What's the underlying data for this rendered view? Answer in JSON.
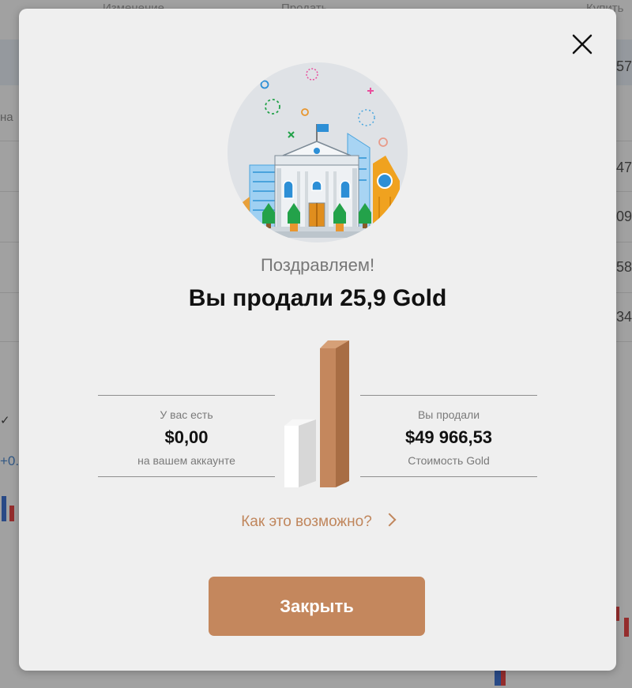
{
  "background": {
    "columns": [
      "Изменение",
      "Продать",
      "Купить"
    ],
    "side_values": [
      "57",
      "47",
      "09",
      "58",
      "34"
    ],
    "left_label": "на",
    "left_value": "+0.",
    "left_check": "✓"
  },
  "dialog": {
    "greeting": "Поздравляем!",
    "headline": "Вы продали 25,9 Gold",
    "balance": {
      "label": "У вас есть",
      "value": "$0,00",
      "sublabel": "на вашем аккаунте"
    },
    "sold": {
      "label": "Вы продали",
      "value": "$49 966,53",
      "sublabel": "Стоимость Gold"
    },
    "how_link": "Как это возможно?",
    "close_button": "Закрыть",
    "close_icon": "close-icon",
    "illustration": "bank-building-illustration",
    "colors": {
      "accent": "#c4875d",
      "link": "#c0865c"
    }
  }
}
